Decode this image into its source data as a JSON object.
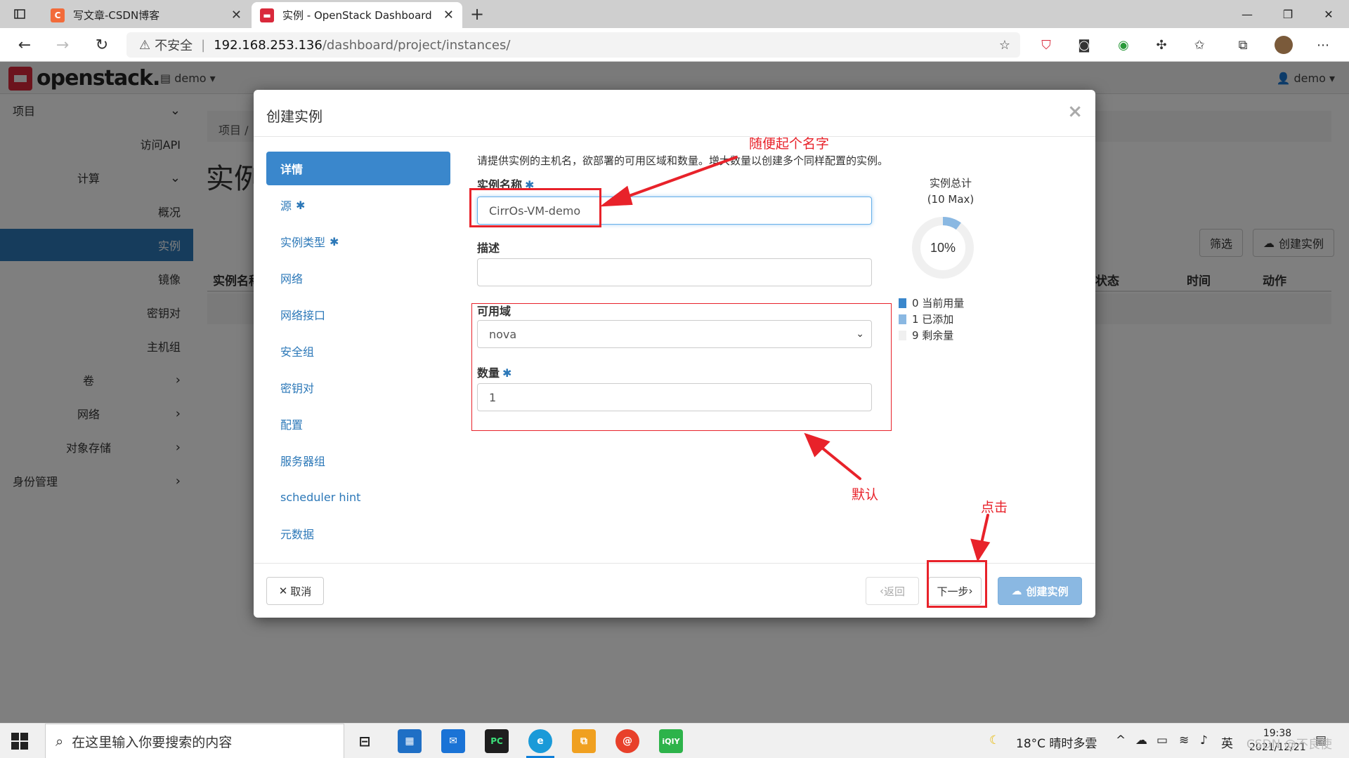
{
  "browser": {
    "tabs": [
      {
        "title": "写文章-CSDN博客",
        "favicon": "C",
        "color": "#f26b3a"
      },
      {
        "title": "实例 - OpenStack Dashboard",
        "favicon": "os",
        "color": "#d9293b"
      }
    ],
    "security_label": "不安全",
    "url_host": "192.168.253.136",
    "url_path": "/dashboard/project/instances/"
  },
  "header": {
    "logo_text": "openstack.",
    "project": "demo",
    "user": "demo"
  },
  "sidebar": {
    "items": [
      {
        "label": "项目",
        "chevron": "down"
      },
      {
        "label": "访问API"
      },
      {
        "label": "计算",
        "chevron": "down"
      },
      {
        "label": "概况"
      },
      {
        "label": "实例",
        "active": true
      },
      {
        "label": "镜像"
      },
      {
        "label": "密钥对"
      },
      {
        "label": "主机组"
      },
      {
        "label": "卷",
        "chevron": "right"
      },
      {
        "label": "网络",
        "chevron": "right"
      },
      {
        "label": "对象存储",
        "chevron": "right"
      },
      {
        "label": "身份管理",
        "chevron": "right"
      }
    ]
  },
  "main": {
    "breadcrumb": "项目 /",
    "title": "实例",
    "filter_label": "筛选",
    "create_label": "创建实例",
    "columns": {
      "name": "实例名称",
      "status": "状态",
      "time": "时间",
      "action": "动作"
    }
  },
  "modal": {
    "title": "创建实例",
    "steps": [
      {
        "label": "详情",
        "active": true
      },
      {
        "label": "源",
        "required": true
      },
      {
        "label": "实例类型",
        "required": true
      },
      {
        "label": "网络"
      },
      {
        "label": "网络接口"
      },
      {
        "label": "安全组"
      },
      {
        "label": "密钥对"
      },
      {
        "label": "配置"
      },
      {
        "label": "服务器组"
      },
      {
        "label": "scheduler hint"
      },
      {
        "label": "元数据"
      }
    ],
    "intro": "请提供实例的主机名，欲部署的可用区域和数量。增大数量以创建多个同样配置的实例。",
    "fields": {
      "name_label": "实例名称",
      "name_value": "CirrOs-VM-demo",
      "desc_label": "描述",
      "desc_value": "",
      "zone_label": "可用域",
      "zone_value": "nova",
      "count_label": "数量",
      "count_value": "1"
    },
    "quota": {
      "title": "实例总计",
      "subtitle": "(10 Max)",
      "percent_label": "10%",
      "used_fraction": 0.1,
      "legend": [
        {
          "label": "0 当前用量",
          "color": "#3a87cc"
        },
        {
          "label": "1 已添加",
          "color": "#8ab8e2"
        },
        {
          "label": "9 剩余量",
          "color": "#f0f0f0"
        }
      ]
    },
    "buttons": {
      "cancel": "取消",
      "back": "返回",
      "next": "下一步",
      "launch": "创建实例"
    }
  },
  "annotations": {
    "name_hint": "随便起个名字",
    "default_hint": "默认",
    "click_hint": "点击"
  },
  "taskbar": {
    "search_placeholder": "在这里输入你要搜索的内容",
    "weather": "18°C 晴时多雲",
    "ime": "英",
    "time": "19:38",
    "date": "2021/12/21",
    "watermark": "CSDN @不良使"
  }
}
